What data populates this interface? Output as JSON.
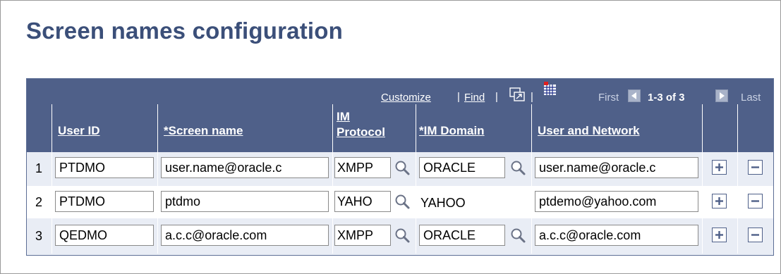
{
  "page": {
    "title": "Screen names configuration"
  },
  "grid": {
    "nav": {
      "customize": "Customize",
      "separator": "|",
      "find": "Find",
      "first": "First",
      "range": "1-3 of 3",
      "last": "Last"
    },
    "columns": {
      "user_id": "User ID",
      "screen_name": "*Screen name",
      "im_protocol_1": "IM",
      "im_protocol_2": "Protocol",
      "im_domain": "*IM Domain",
      "user_network": "User and Network"
    },
    "rows": [
      {
        "num": "1",
        "user_id": "PTDMO",
        "screen_name": "user.name@oracle.c",
        "protocol": "XMPP",
        "domain": "ORACLE",
        "domain_editable": true,
        "network": "user.name@oracle.c"
      },
      {
        "num": "2",
        "user_id": "PTDMO",
        "screen_name": "ptdmo",
        "protocol": "YAHO",
        "domain": "YAHOO",
        "domain_editable": false,
        "network": "ptdemo@yahoo.com"
      },
      {
        "num": "3",
        "user_id": "QEDMO",
        "screen_name": "a.c.c@oracle.com",
        "protocol": "XMPP",
        "domain": "ORACLE",
        "domain_editable": true,
        "network": "a.c.c@oracle.com"
      }
    ]
  },
  "icons": {
    "lookup": "magnifier-icon",
    "add": "plus-icon",
    "delete": "minus-icon",
    "new_window": "new-window-icon",
    "download": "spreadsheet-icon"
  },
  "colors": {
    "header_bg": "#4f6089",
    "title": "#3b4f79",
    "row_alt": "#e9edf5"
  }
}
